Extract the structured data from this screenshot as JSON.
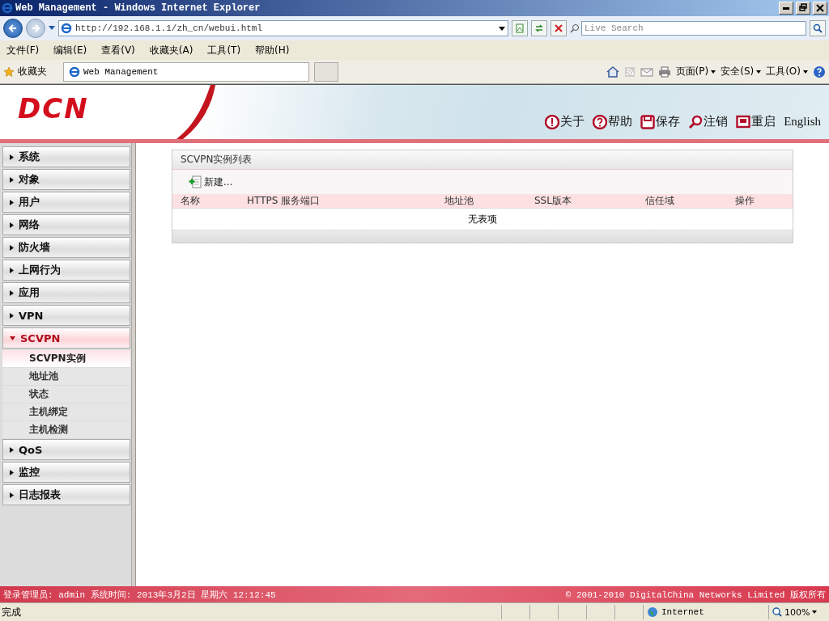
{
  "window": {
    "title": "Web Management - Windows Internet Explorer"
  },
  "browser": {
    "address": "http://192.168.1.1/zh_cn/webui.html",
    "search_placeholder": "Live Search",
    "menu": [
      "文件(F)",
      "编辑(E)",
      "查看(V)",
      "收藏夹(A)",
      "工具(T)",
      "帮助(H)"
    ],
    "favorites_label": "收藏夹",
    "tab_title": "Web Management",
    "commands": [
      "页面(P)",
      "安全(S)",
      "工具(O)"
    ]
  },
  "header": {
    "logo": "DCN",
    "links": [
      {
        "kind": "about",
        "label": "关于"
      },
      {
        "kind": "help",
        "label": "帮助"
      },
      {
        "kind": "save",
        "label": "保存"
      },
      {
        "kind": "logout",
        "label": "注销"
      },
      {
        "kind": "restart",
        "label": "重启"
      },
      {
        "kind": "language",
        "label": "English"
      }
    ]
  },
  "sidebar": {
    "items": [
      {
        "label": "系统",
        "expanded": false
      },
      {
        "label": "对象",
        "expanded": false
      },
      {
        "label": "用户",
        "expanded": false
      },
      {
        "label": "网络",
        "expanded": false
      },
      {
        "label": "防火墙",
        "expanded": false
      },
      {
        "label": "上网行为",
        "expanded": false
      },
      {
        "label": "应用",
        "expanded": false
      },
      {
        "label": "VPN",
        "expanded": false
      },
      {
        "label": "SCVPN",
        "expanded": true,
        "children": [
          {
            "label": "SCVPN实例",
            "selected": true
          },
          {
            "label": "地址池",
            "selected": false
          },
          {
            "label": "状态",
            "selected": false
          },
          {
            "label": "主机绑定",
            "selected": false
          },
          {
            "label": "主机检测",
            "selected": false
          }
        ]
      },
      {
        "label": "QoS",
        "expanded": false
      },
      {
        "label": "监控",
        "expanded": false
      },
      {
        "label": "日志报表",
        "expanded": false
      }
    ]
  },
  "panel": {
    "title": "SCVPN实例列表",
    "new_button": "新建...",
    "table": {
      "columns": [
        "名称",
        "HTTPS 服务端口",
        "地址池",
        "SSL版本",
        "信任域",
        "操作"
      ],
      "empty_text": "无表项"
    }
  },
  "footer": {
    "login_info": "登录管理员: admin 系统时间: 2013年3月2日 星期六 12:12:45",
    "copyright": "© 2001-2010 DigitalChina Networks Limited 版权所有"
  },
  "status_bar": {
    "status": "完成",
    "zone": "Internet",
    "zoom": "100%"
  }
}
